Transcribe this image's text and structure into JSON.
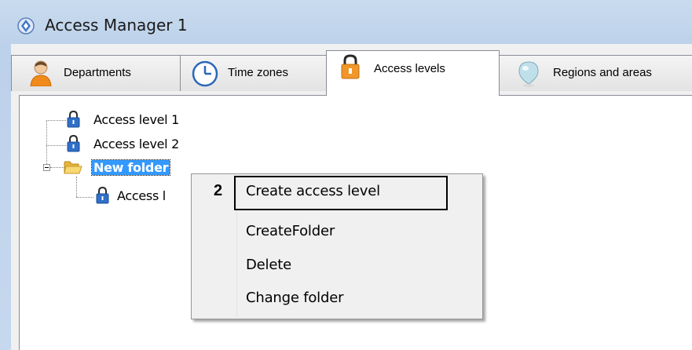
{
  "window": {
    "title": "Access Manager 1"
  },
  "tabs": [
    {
      "label": "Departments",
      "icon": "person-icon",
      "active": false
    },
    {
      "label": "Time zones",
      "icon": "clock-icon",
      "active": false
    },
    {
      "label": "Access levels",
      "icon": "lock-icon",
      "active": true
    },
    {
      "label": "Regions and areas",
      "icon": "map-pin-icon",
      "active": false
    }
  ],
  "tree": {
    "items": [
      {
        "label": "Access level 1",
        "icon": "lock-icon"
      },
      {
        "label": "Access level 2",
        "icon": "lock-icon"
      },
      {
        "label": "New folder",
        "icon": "folder-open-icon",
        "selected": true,
        "expanded": true
      },
      {
        "label": "Access l",
        "icon": "lock-icon",
        "child": true
      }
    ]
  },
  "context_menu": {
    "items": [
      {
        "label": "Create access level"
      },
      {
        "label": "CreateFolder"
      },
      {
        "label": "Delete"
      },
      {
        "label": "Change folder"
      }
    ]
  },
  "callout": {
    "number": "2"
  },
  "colors": {
    "selection": "#3399ff",
    "lock_body": "#2f6fc7",
    "folder": "#f2c94c"
  }
}
